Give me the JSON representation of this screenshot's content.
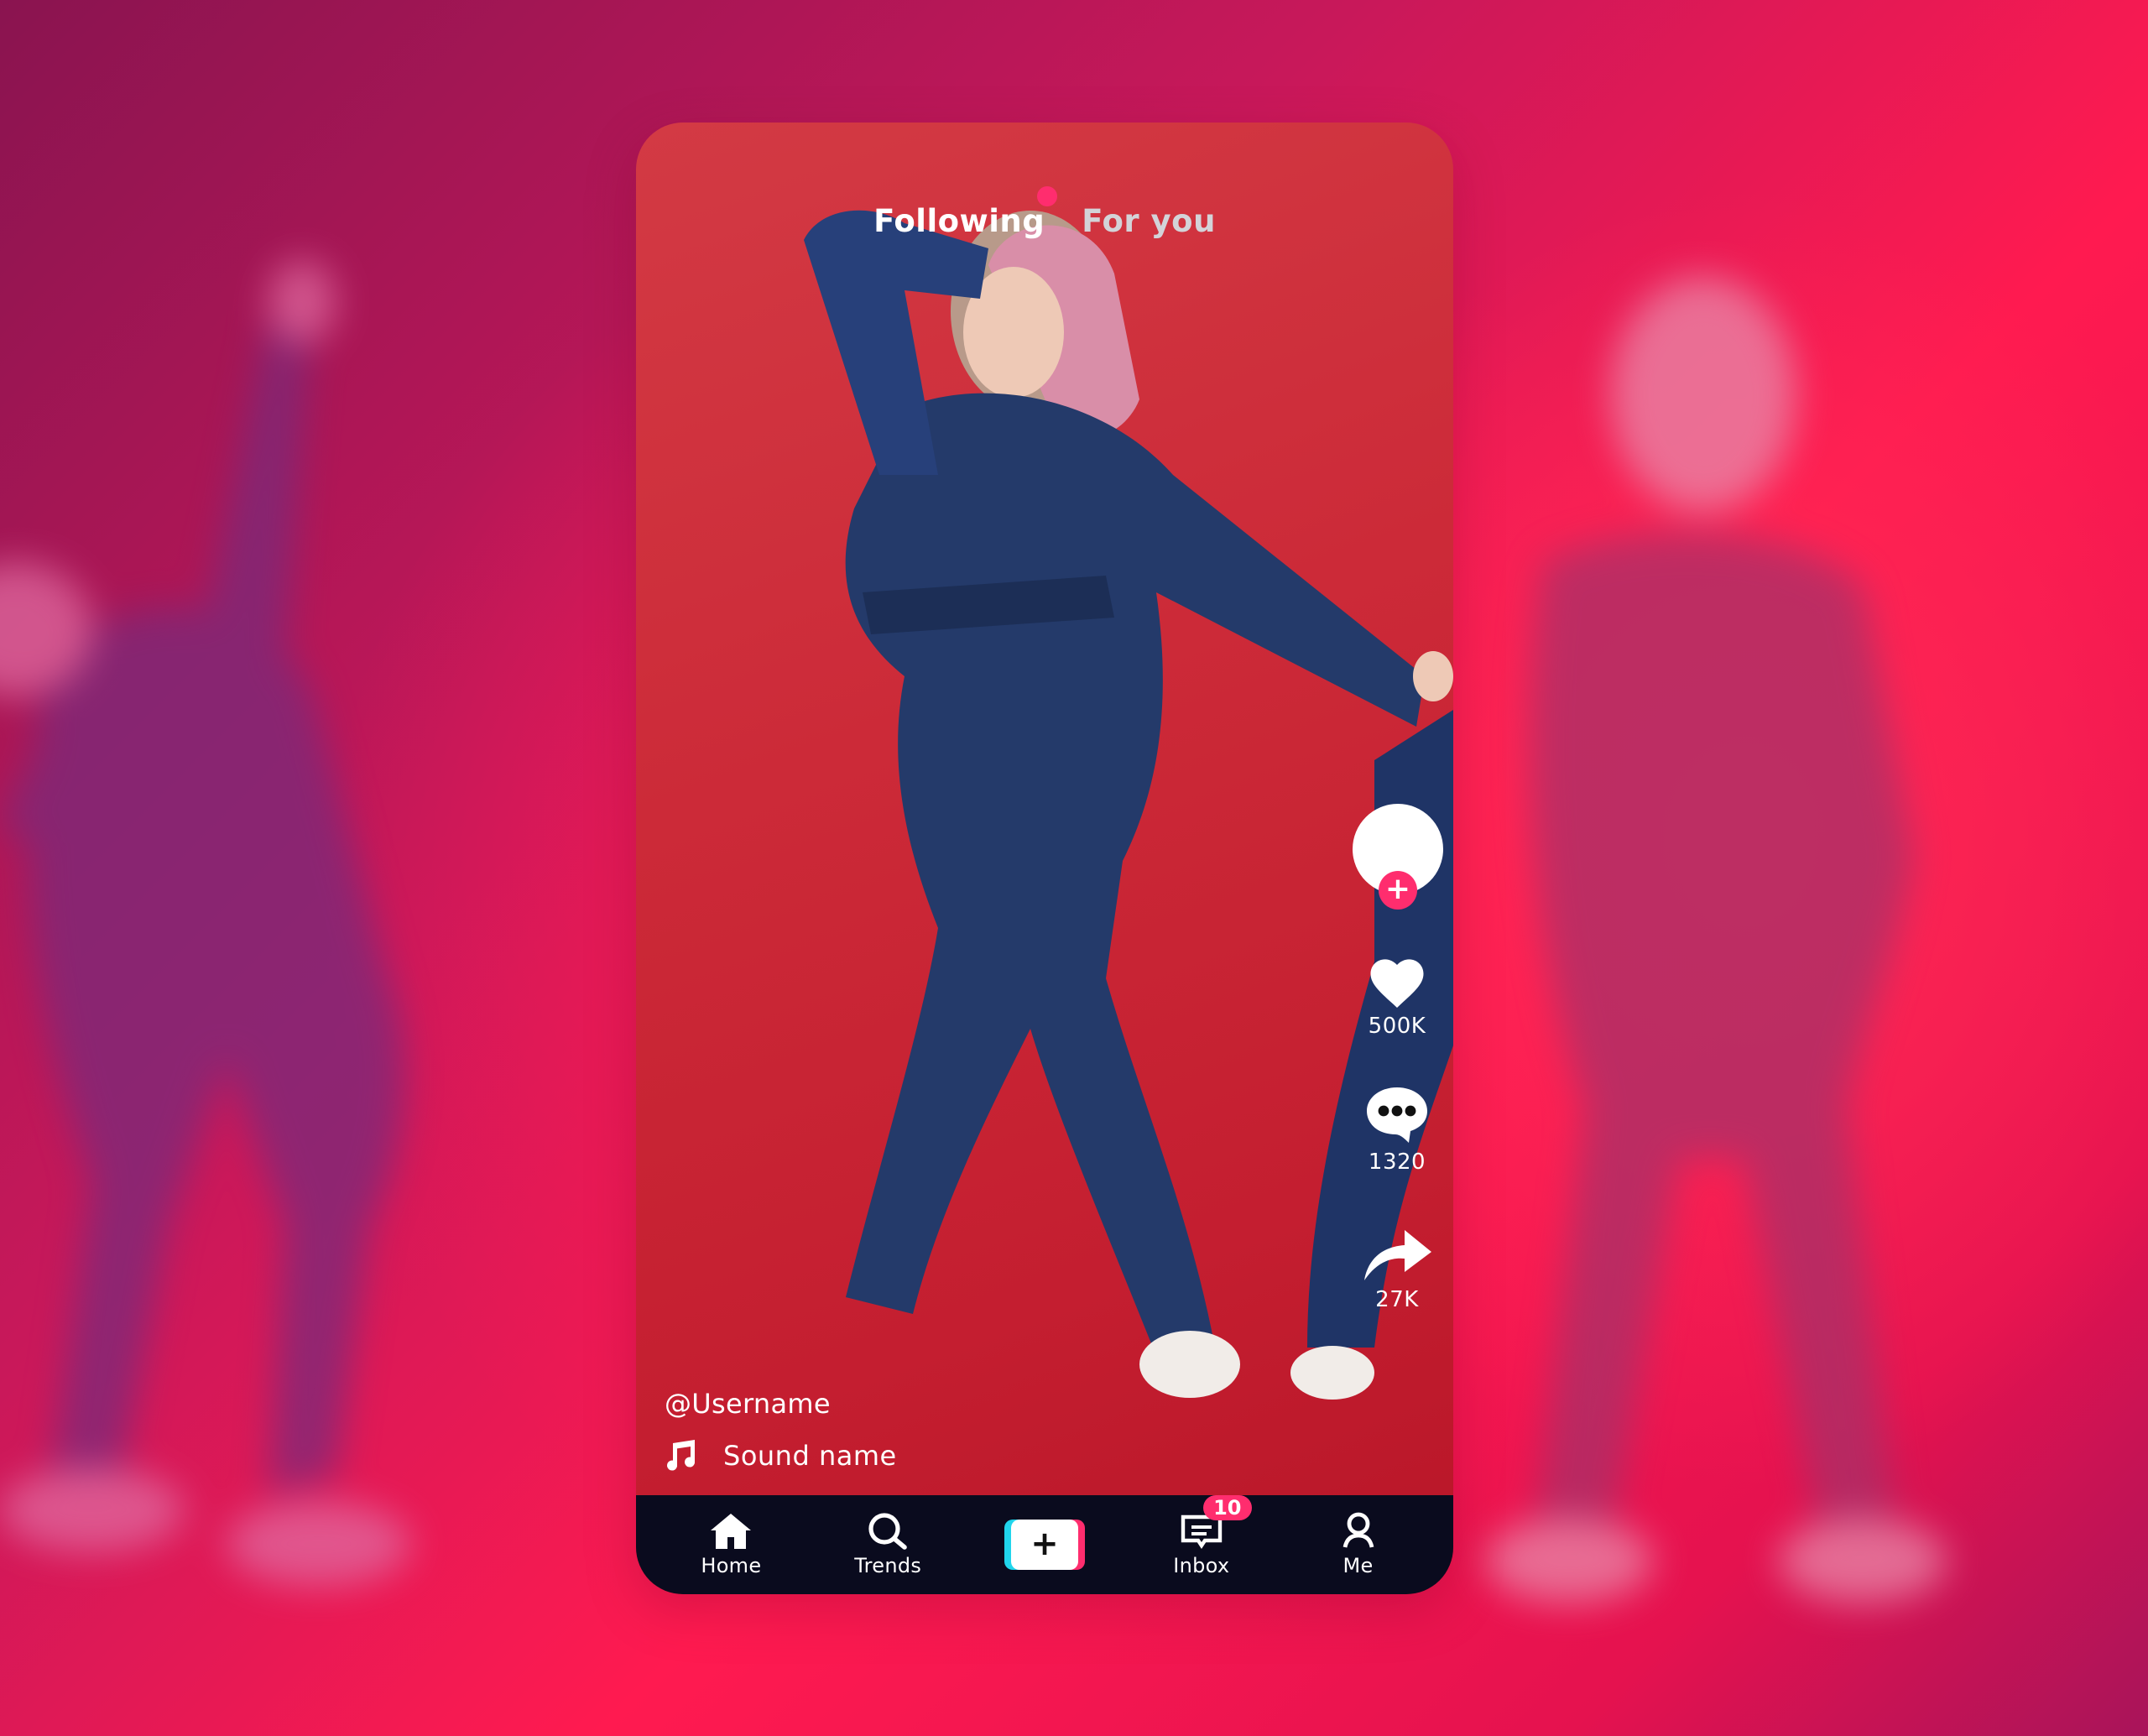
{
  "feed_tabs": {
    "following_label": "Following",
    "for_you_label": "For you",
    "active": "Following"
  },
  "video": {
    "username": "@Username",
    "sound_name": "Sound name",
    "description": "Woman in denim jumpsuit dancing against red background"
  },
  "actions": {
    "follow_symbol": "+",
    "likes": "500K",
    "comments": "1320",
    "shares": "27K"
  },
  "navbar": {
    "items": [
      {
        "label": "Home",
        "icon": "home-icon"
      },
      {
        "label": "Trends",
        "icon": "search-icon"
      },
      {
        "label": "",
        "icon": "plus-icon",
        "symbol": "+"
      },
      {
        "label": "Inbox",
        "icon": "inbox-icon",
        "badge": "10"
      },
      {
        "label": "Me",
        "icon": "user-icon"
      }
    ]
  },
  "colors": {
    "accent_pink": "#ff2d6e",
    "accent_cyan": "#20d5ec",
    "navbar_bg": "#0a0b1e",
    "video_bg_red": "#cc2a38",
    "page_bg_pink": "#ff1a50"
  }
}
